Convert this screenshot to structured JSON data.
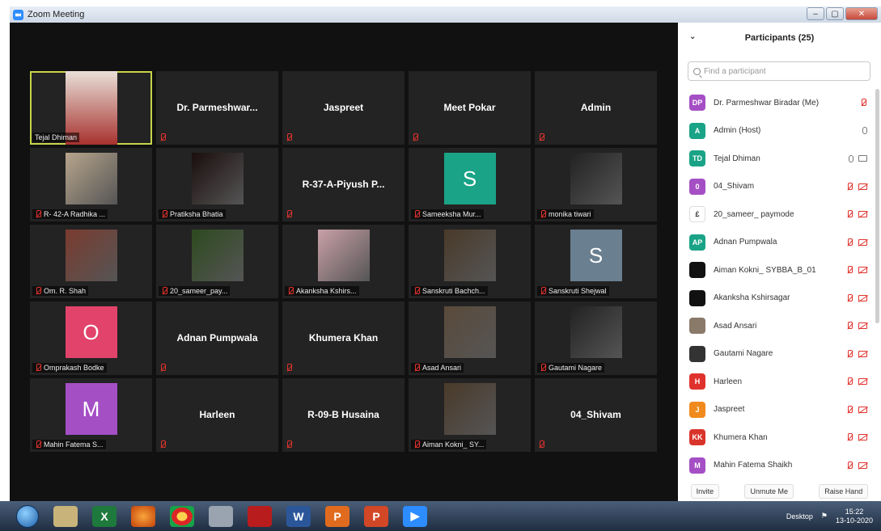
{
  "window": {
    "title": "Zoom Meeting",
    "minimize": "–",
    "maximize": "▢",
    "close": "✕"
  },
  "gallery": {
    "tiles": [
      {
        "name": "Tejal Dhiman",
        "kind": "photo",
        "active": true
      },
      {
        "name": "Dr. Parmeshwar...",
        "kind": "text"
      },
      {
        "name": "Jaspreet",
        "kind": "text"
      },
      {
        "name": "Meet Pokar",
        "kind": "text"
      },
      {
        "name": "Admin",
        "kind": "text"
      },
      {
        "name": "R- 42-A Radhika ...",
        "kind": "photo"
      },
      {
        "name": "Pratiksha Bhatia",
        "kind": "photo"
      },
      {
        "name": "R-37-A-Piyush P...",
        "kind": "text"
      },
      {
        "name": "Sameeksha Mur...",
        "kind": "letter",
        "letter": "S",
        "color": "#1aa386"
      },
      {
        "name": "monika tiwari",
        "kind": "photo"
      },
      {
        "name": "Om. R. Shah",
        "kind": "photo"
      },
      {
        "name": "20_sameer_pay...",
        "kind": "photo"
      },
      {
        "name": "Akanksha Kshirs...",
        "kind": "photo"
      },
      {
        "name": "Sanskruti Bachch...",
        "kind": "photo"
      },
      {
        "name": "Sanskruti Shejwal",
        "kind": "letter",
        "letter": "S",
        "color": "#6a7f8f"
      },
      {
        "name": "Omprakash Bodke",
        "kind": "letter",
        "letter": "O",
        "color": "#e2436a"
      },
      {
        "name": "Adnan Pumpwala",
        "kind": "text"
      },
      {
        "name": "Khumera Khan",
        "kind": "text"
      },
      {
        "name": "Asad Ansari",
        "kind": "photo"
      },
      {
        "name": "Gautami Nagare",
        "kind": "photo"
      },
      {
        "name": "Mahin Fatema S...",
        "kind": "letter",
        "letter": "M",
        "color": "#a54fc5"
      },
      {
        "name": "Harleen",
        "kind": "text"
      },
      {
        "name": "R-09-B Husaina",
        "kind": "text"
      },
      {
        "name": "Aiman Kokni_ SY...",
        "kind": "photo"
      },
      {
        "name": "04_Shivam",
        "kind": "text"
      }
    ]
  },
  "participants": {
    "title": "Participants (25)",
    "search_placeholder": "Find a participant",
    "list": [
      {
        "initials": "DP",
        "name": "Dr. Parmeshwar Biradar (Me)",
        "color": "#a54fc5",
        "mic": "muted",
        "video": "none"
      },
      {
        "initials": "A",
        "name": "Admin (Host)",
        "color": "#1aa386",
        "mic": "on",
        "video": "none"
      },
      {
        "initials": "TD",
        "name": "Tejal Dhiman",
        "color": "#1aa386",
        "mic": "on",
        "video": "on"
      },
      {
        "initials": "0",
        "name": "04_Shivam",
        "color": "#a54fc5",
        "mic": "muted",
        "video": "muted"
      },
      {
        "initials": "£",
        "name": "20_sameer_ paymode",
        "color": "#ffffff",
        "mic": "muted",
        "video": "muted"
      },
      {
        "initials": "AP",
        "name": "Adnan Pumpwala",
        "color": "#1aa386",
        "mic": "muted",
        "video": "muted"
      },
      {
        "initials": "",
        "name": "Aiman Kokni_ SYBBA_B_01",
        "color": "#111111",
        "mic": "muted",
        "video": "muted"
      },
      {
        "initials": "",
        "name": "Akanksha Kshirsagar",
        "color": "#111111",
        "mic": "muted",
        "video": "muted"
      },
      {
        "initials": "",
        "name": "Asad Ansari",
        "color": "#8a7a6a",
        "mic": "muted",
        "video": "muted"
      },
      {
        "initials": "",
        "name": "Gautami Nagare",
        "color": "#333333",
        "mic": "muted",
        "video": "muted"
      },
      {
        "initials": "H",
        "name": "Harleen",
        "color": "#e0322c",
        "mic": "muted",
        "video": "muted"
      },
      {
        "initials": "J",
        "name": "Jaspreet",
        "color": "#f08a1c",
        "mic": "muted",
        "video": "muted"
      },
      {
        "initials": "KK",
        "name": "Khumera Khan",
        "color": "#d9342b",
        "mic": "muted",
        "video": "muted"
      },
      {
        "initials": "M",
        "name": "Mahin Fatema Shaikh",
        "color": "#a54fc5",
        "mic": "muted",
        "video": "muted"
      }
    ],
    "footer": {
      "invite": "Invite",
      "unmute": "Unmute Me",
      "raise": "Raise Hand"
    }
  },
  "taskbar": {
    "desktop_label": "Desktop",
    "time": "15:22",
    "date": "13-10-2020"
  }
}
